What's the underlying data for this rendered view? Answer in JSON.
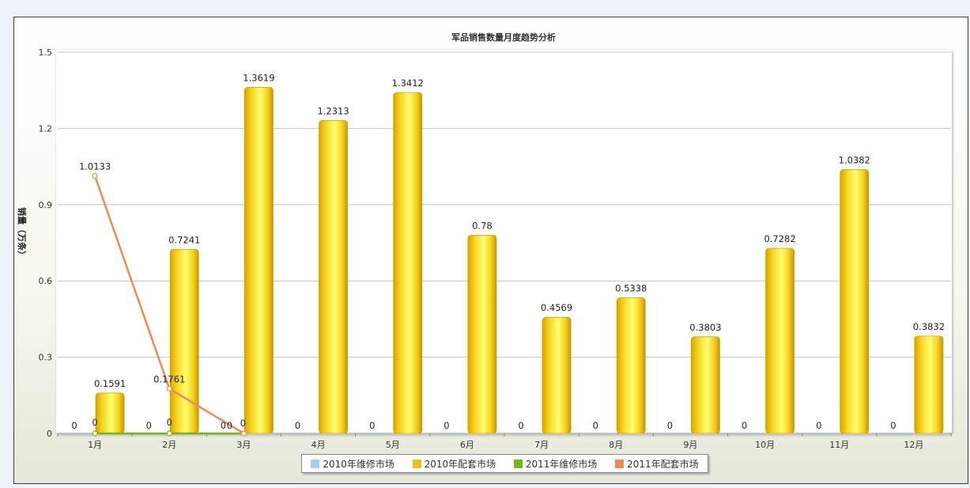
{
  "chart_data": {
    "type": "bar",
    "title": "军品销售数量月度趋势分析",
    "ylabel": "销量（万条）",
    "xlabel": "",
    "ylim": [
      0,
      1.5
    ],
    "yticks": [
      "0",
      "0.3",
      "0.6",
      "0.9",
      "1.2",
      "1.5"
    ],
    "grid": true,
    "legend_position": "bottom",
    "categories": [
      "1月",
      "2月",
      "3月",
      "4月",
      "5月",
      "6月",
      "7月",
      "8月",
      "9月",
      "10月",
      "11月",
      "12月"
    ],
    "series": [
      {
        "name": "2010年维修市场",
        "type": "bar",
        "color": "#a8cdf2",
        "values": [
          0,
          0,
          0,
          0,
          0,
          0,
          0,
          0,
          0,
          0,
          0,
          0
        ],
        "labels": [
          "0",
          "0",
          "0",
          "0",
          "0",
          "0",
          "0",
          "0",
          "0",
          "0",
          "0",
          "0"
        ]
      },
      {
        "name": "2010年配套市场",
        "type": "bar",
        "color": "#f0c020",
        "values": [
          0.1591,
          0.7241,
          1.3619,
          1.2313,
          1.3412,
          0.78,
          0.4569,
          0.5338,
          0.3803,
          0.7282,
          1.0382,
          0.3832
        ],
        "labels": [
          "0.1591",
          "0.7241",
          "1.3619",
          "1.2313",
          "1.3412",
          "0.78",
          "0.4569",
          "0.5338",
          "0.3803",
          "0.7282",
          "1.0382",
          "0.3832"
        ]
      },
      {
        "name": "2011年维修市场",
        "type": "line",
        "color": "#7ab51d",
        "values": [
          0,
          0,
          0
        ],
        "labels": [
          "0",
          "0",
          "0"
        ]
      },
      {
        "name": "2011年配套市场",
        "type": "line",
        "color": "#ee8a55",
        "values": [
          1.0133,
          0.1761,
          0
        ],
        "labels": [
          "1.0133",
          "0.1761",
          "0"
        ]
      }
    ]
  }
}
